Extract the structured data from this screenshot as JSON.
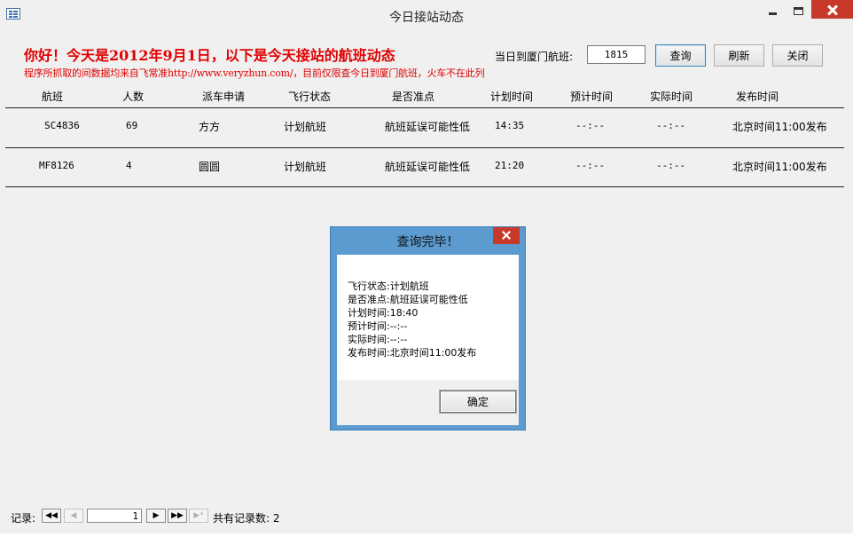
{
  "window": {
    "title": "今日接站动态"
  },
  "header": {
    "greeting": "你好！今天是2012年9月1日，以下是今天接站的航班动态",
    "note": "程序所抓取的间数据均来自飞常准http://www.veryzhun.com/，目前仅限查今日到厦门航班，火车不在此列",
    "flight_label": "当日到厦门航班:",
    "flight_value": "1815",
    "query_button": "查询",
    "refresh_button": "刷新",
    "close_button": "关闭"
  },
  "table": {
    "columns": [
      "航班",
      "人数",
      "派车申请",
      "飞行状态",
      "是否准点",
      "计划时间",
      "预计时间",
      "实际时间",
      "发布时间"
    ],
    "rows": [
      [
        "SC4836",
        "69",
        "方方",
        "计划航班",
        "航班延误可能性低",
        "14:35",
        "--:--",
        "--:--",
        "北京时间11:00发布"
      ],
      [
        "MF8126",
        "4",
        "圆圆",
        "计划航班",
        "航班延误可能性低",
        "21:20",
        "--:--",
        "--:--",
        "北京时间11:00发布"
      ]
    ]
  },
  "dialog": {
    "title": "查询完毕！",
    "lines": [
      "飞行状态:计划航班",
      "是否准点:航班延误可能性低",
      "计划时间:18:40",
      "预计时间:--:--",
      "实际时间:--:--",
      "发布时间:北京时间11:00发布"
    ],
    "ok_button": "确定"
  },
  "navigator": {
    "label": "记录:",
    "current": "1",
    "first": "◀◀",
    "prev": "◀",
    "next": "▶",
    "last": "▶▶",
    "new": "▶*",
    "count_text": "共有记录数: 2"
  },
  "colors": {
    "accent_red": "#e00000",
    "dialog_frame": "#5b9bd0",
    "close_red": "#c7392b"
  }
}
